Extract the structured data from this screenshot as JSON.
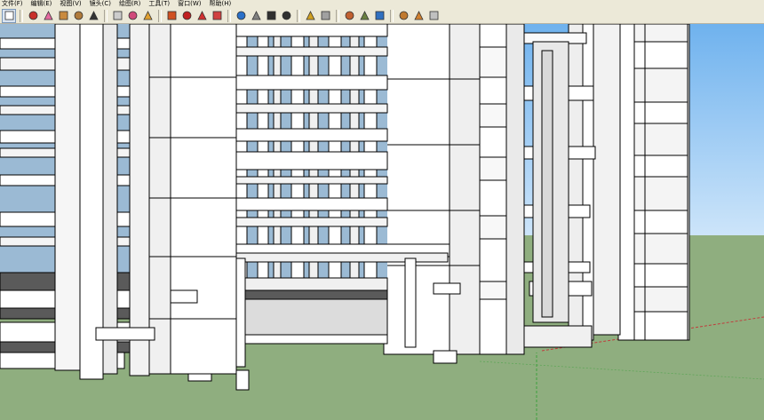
{
  "menu": {
    "items": [
      "文件(F)",
      "编辑(E)",
      "视图(V)",
      "镜头(C)",
      "绘图(R)",
      "工具(T)",
      "窗口(W)",
      "帮助(H)"
    ]
  },
  "toolbar": {
    "tools": [
      {
        "name": "select-tool-icon",
        "color": "#ffffff"
      },
      {
        "name": "pencil-tool-icon",
        "color": "#c8302a"
      },
      {
        "name": "eraser-tool-icon",
        "color": "#e66aa0"
      },
      {
        "name": "rectangle-tool-icon",
        "color": "#c98a3e"
      },
      {
        "name": "circle-tool-icon",
        "color": "#b07a3a"
      },
      {
        "name": "arc-tool-icon",
        "color": "#333333"
      },
      {
        "name": "polygon-tool-icon",
        "color": "#cccccc"
      },
      {
        "name": "paint-bucket-tool-icon",
        "color": "#d04a7a"
      },
      {
        "name": "tape-measure-tool-icon",
        "color": "#e0a030"
      },
      {
        "name": "push-pull-tool-icon",
        "color": "#d05020"
      },
      {
        "name": "move-tool-icon",
        "color": "#c02020"
      },
      {
        "name": "rotate-tool-icon",
        "color": "#d03030"
      },
      {
        "name": "offset-tool-icon",
        "color": "#d04040"
      },
      {
        "name": "orbit-tool-icon",
        "color": "#2a70c8"
      },
      {
        "name": "pan-tool-icon",
        "color": "#808080"
      },
      {
        "name": "zoom-tool-icon",
        "color": "#303030"
      },
      {
        "name": "zoom-extents-tool-icon",
        "color": "#303030"
      },
      {
        "name": "dimension-tool-icon",
        "color": "#d0a020"
      },
      {
        "name": "section-plane-tool-icon",
        "color": "#a0a0a0"
      },
      {
        "name": "walk-tool-icon",
        "color": "#c06030"
      },
      {
        "name": "look-around-tool-icon",
        "color": "#6a8040"
      },
      {
        "name": "position-camera-tool-icon",
        "color": "#3070c0"
      },
      {
        "name": "components-icon",
        "color": "#c07a30"
      },
      {
        "name": "materials-icon",
        "color": "#d08030"
      },
      {
        "name": "styles-icon",
        "color": "#c0c0c0"
      }
    ]
  },
  "scene": {
    "sky_color": "#9cc8f0",
    "ground_color": "#8fae7f",
    "structure_color": "#ffffff",
    "shadow_color": "#4a4a4a",
    "axis_green": "#3ca03c",
    "axis_red": "#c03c3c"
  }
}
